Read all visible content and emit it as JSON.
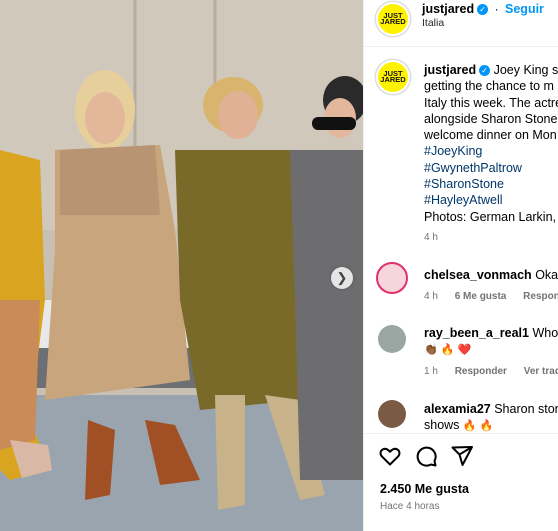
{
  "post": {
    "account": "justjared",
    "follow_label": "Seguir",
    "location": "Italia",
    "logo_text_top": "JUST",
    "logo_text_bottom": "JARED",
    "caption_lines": [
      "Joey King sa",
      "getting the chance to m",
      "Italy this week. The actre",
      "alongside Sharon Stone",
      "welcome dinner on Mon"
    ],
    "hashtags": [
      "#JoeyKing",
      "#GwynethPaltrow",
      "#SharonStone",
      "#HayleyAtwell"
    ],
    "photo_credit": "Photos: German Larkin, I",
    "caption_time": "4 h"
  },
  "comments": [
    {
      "user": "chelsea_vonmach",
      "text": "Okay",
      "time": "4 h",
      "likes": "6 Me gusta",
      "reply": "Responder",
      "emojis": ""
    },
    {
      "user": "ray_been_a_real1",
      "text": "Whoev",
      "time": "1 h",
      "likes": "",
      "reply": "Responder",
      "translate": "Ver tradu",
      "emojis": "👏🏾 🔥 ❤️"
    },
    {
      "user": "alexamia27",
      "text": "Sharon ston",
      "line2": "shows",
      "emojis": "🔥 🔥"
    }
  ],
  "footer": {
    "likes": "2.450 Me gusta",
    "time_ago": "Hace 4 horas"
  },
  "icons": [
    "heart-icon",
    "comment-icon",
    "share-icon",
    "chevron-right-icon",
    "verified-badge-icon"
  ],
  "colors": {
    "link": "#0095f6",
    "hashtag": "#00376b",
    "logo": "#fff200",
    "muted": "#737373"
  }
}
